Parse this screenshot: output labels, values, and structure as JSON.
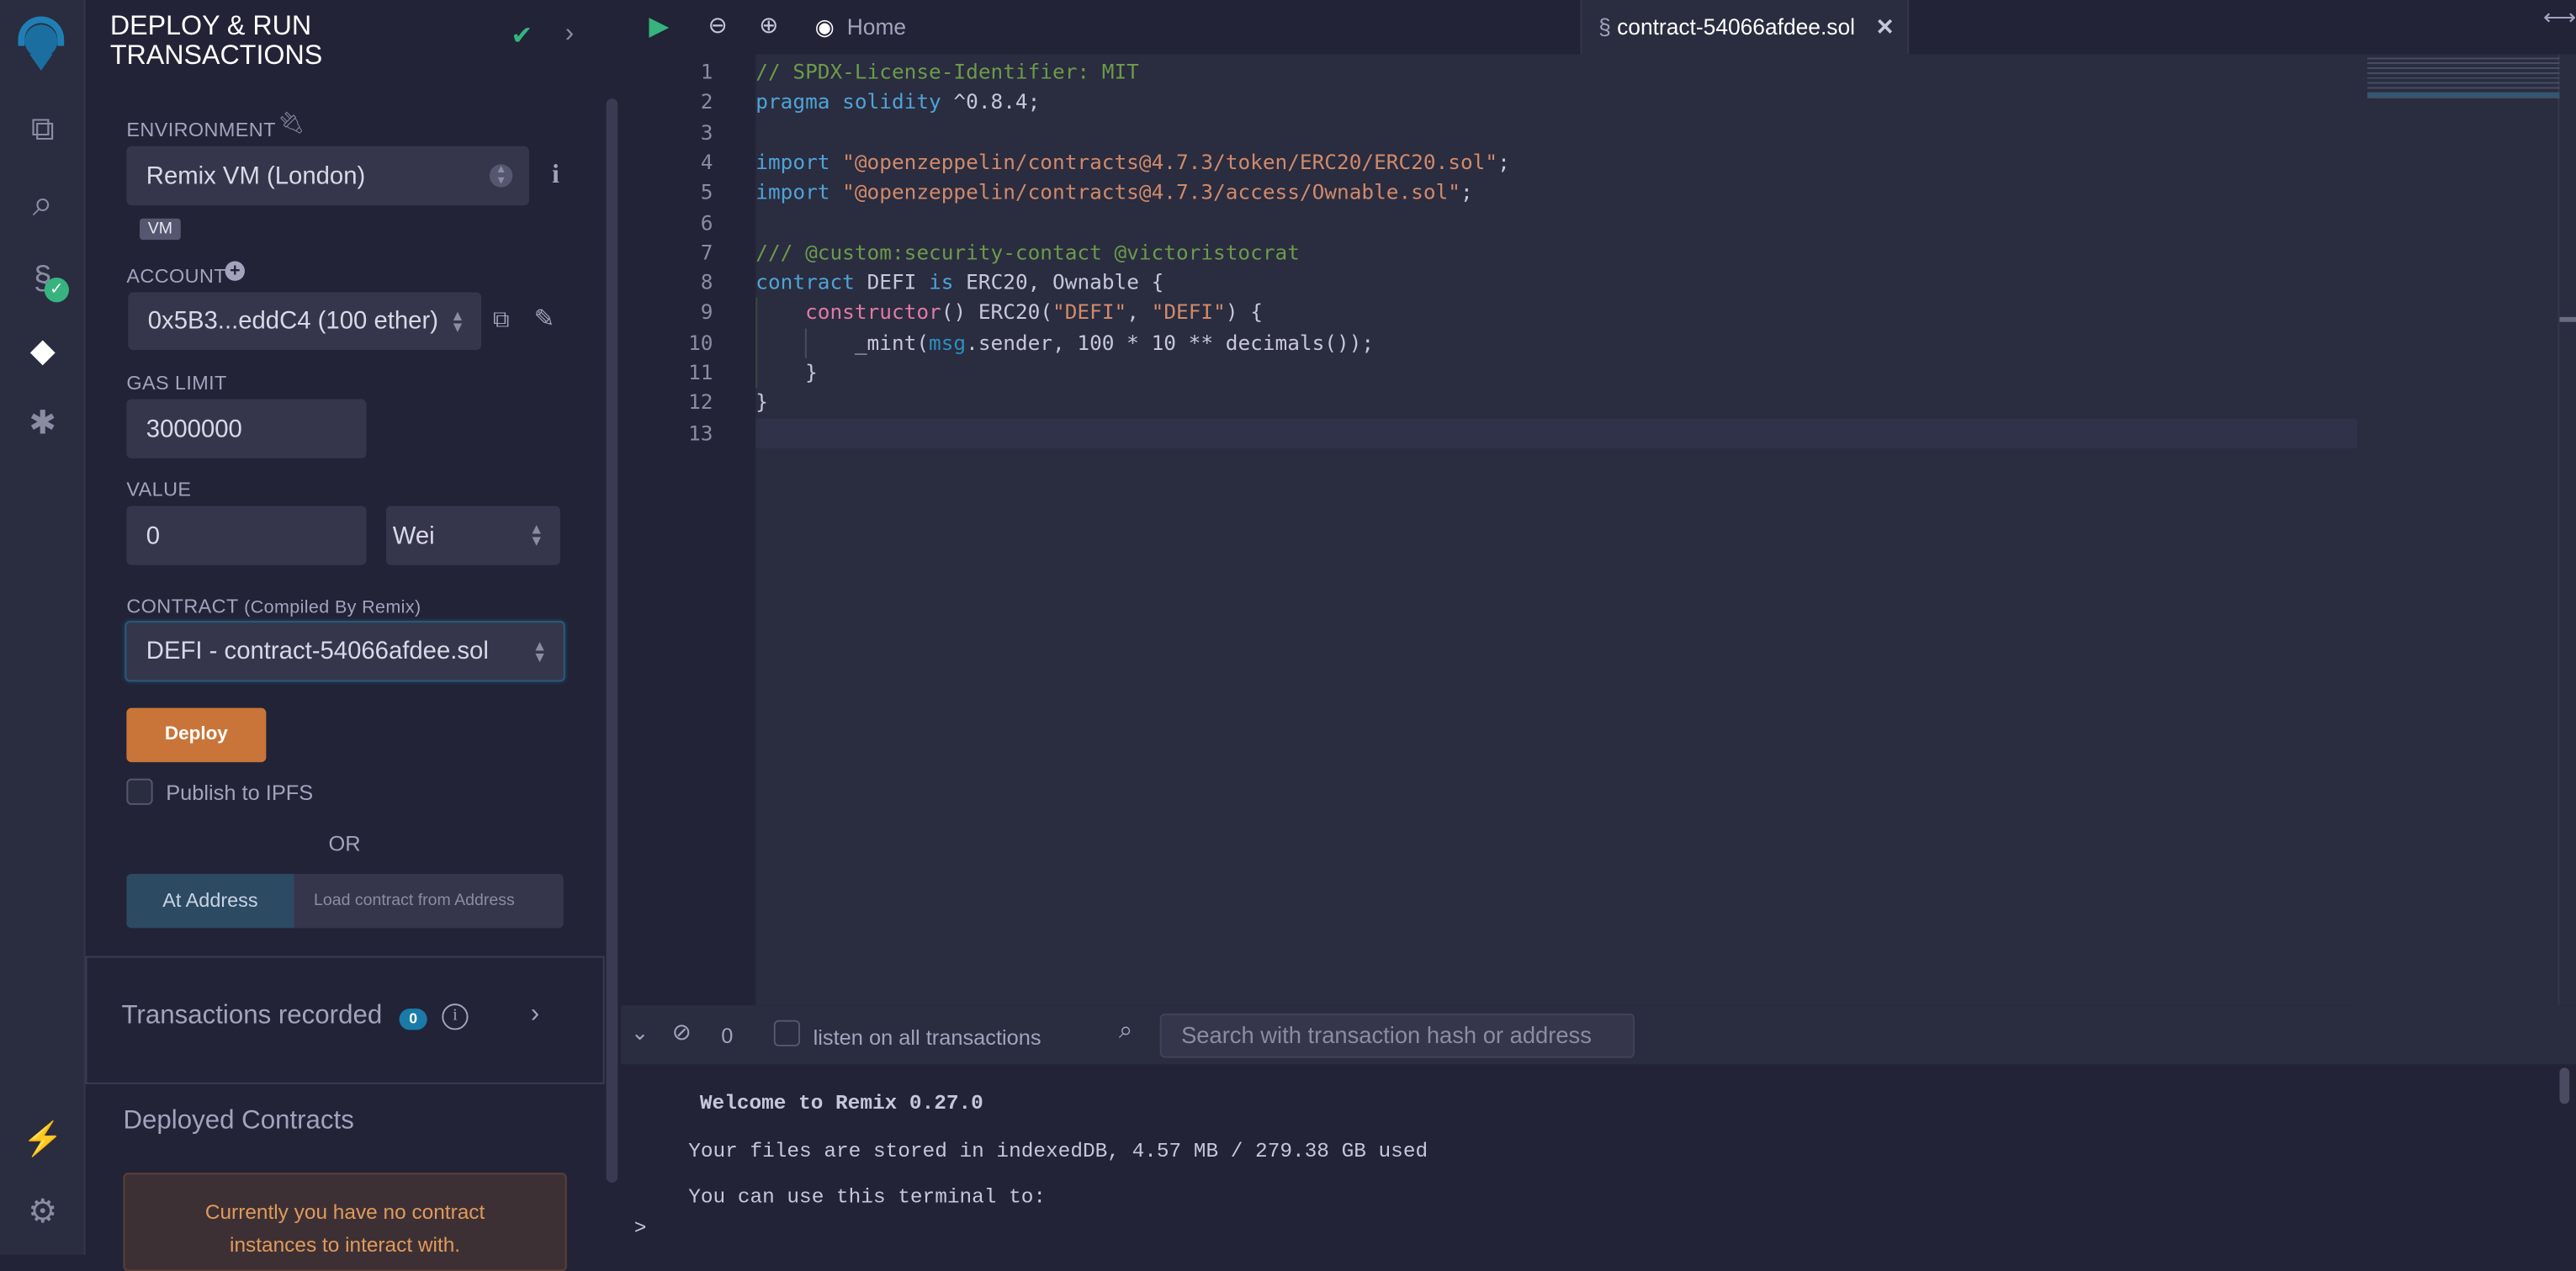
{
  "panel": {
    "title_line1": "DEPLOY & RUN",
    "title_line2": "TRANSACTIONS",
    "environment_label": "ENVIRONMENT",
    "environment_value": "Remix VM (London)",
    "vm_badge": "VM",
    "account_label": "ACCOUNT",
    "account_value": "0x5B3...eddC4 (100 ether)",
    "gas_limit_label": "GAS LIMIT",
    "gas_limit_value": "3000000",
    "value_label": "VALUE",
    "value_amount": "0",
    "value_unit": "Wei",
    "contract_label": "CONTRACT",
    "contract_sublabel": "(Compiled By Remix)",
    "contract_value": "DEFI - contract-54066afdee.sol",
    "deploy_label": "Deploy",
    "publish_ipfs_label": "Publish to IPFS",
    "or_label": "OR",
    "at_address_label": "At Address",
    "at_address_placeholder": "Load contract from Address",
    "tx_recorded_label": "Transactions recorded",
    "tx_recorded_count": "0",
    "deployed_contracts_label": "Deployed Contracts",
    "no_instances_msg": "Currently you have no contract instances to interact with.",
    "colors": {
      "deploy": "#c97539",
      "at_address": "#2d4a63",
      "badge": "#1a7aa8",
      "success": "#36b37e"
    }
  },
  "tabs": {
    "home_label": "Home",
    "file_label": "contract-54066afdee.sol"
  },
  "code": {
    "line_numbers": [
      "1",
      "2",
      "3",
      "4",
      "5",
      "6",
      "7",
      "8",
      "9",
      "10",
      "11",
      "12",
      "13"
    ],
    "lines": [
      [
        {
          "t": "// SPDX-License-Identifier: MIT",
          "c": "cm"
        }
      ],
      [
        {
          "t": "pragma solidity",
          "c": "kw"
        },
        {
          "t": " ^0.8.4;",
          "c": ""
        }
      ],
      [],
      [
        {
          "t": "import",
          "c": "kw"
        },
        {
          "t": " \"@openzeppelin/contracts@4.7.3/token/ERC20/ERC20.sol\"",
          "c": "st"
        },
        {
          "t": ";",
          "c": ""
        }
      ],
      [
        {
          "t": "import",
          "c": "kw"
        },
        {
          "t": " \"@openzeppelin/contracts@4.7.3/access/Ownable.sol\"",
          "c": "st"
        },
        {
          "t": ";",
          "c": ""
        }
      ],
      [],
      [
        {
          "t": "/// @custom:security-contact @victoristocrat",
          "c": "cm"
        }
      ],
      [
        {
          "t": "contract",
          "c": "kw"
        },
        {
          "t": " DEFI ",
          "c": ""
        },
        {
          "t": "is",
          "c": "kw"
        },
        {
          "t": " ERC20, Ownable {",
          "c": ""
        }
      ],
      [
        {
          "t": "    ",
          "c": ""
        },
        {
          "t": "constructor",
          "c": "fn"
        },
        {
          "t": "() ERC20(",
          "c": ""
        },
        {
          "t": "\"DEFI\"",
          "c": "st"
        },
        {
          "t": ", ",
          "c": ""
        },
        {
          "t": "\"DEFI\"",
          "c": "st"
        },
        {
          "t": ") {",
          "c": ""
        }
      ],
      [
        {
          "t": "        _mint(",
          "c": ""
        },
        {
          "t": "msg",
          "c": "ms"
        },
        {
          "t": ".sender, 100 * 10 ** decimals());",
          "c": ""
        }
      ],
      [
        {
          "t": "    }",
          "c": ""
        }
      ],
      [
        {
          "t": "}",
          "c": ""
        }
      ],
      []
    ]
  },
  "terminal": {
    "pending_count": "0",
    "listen_label": "listen on all transactions",
    "search_placeholder": "Search with transaction hash or address",
    "welcome": "Welcome to Remix 0.27.0",
    "storage_msg": "Your files are stored in indexedDB, 4.57 MB / 279.38 GB used",
    "usage_msg": "You can use this terminal to:",
    "prompt": ">"
  }
}
